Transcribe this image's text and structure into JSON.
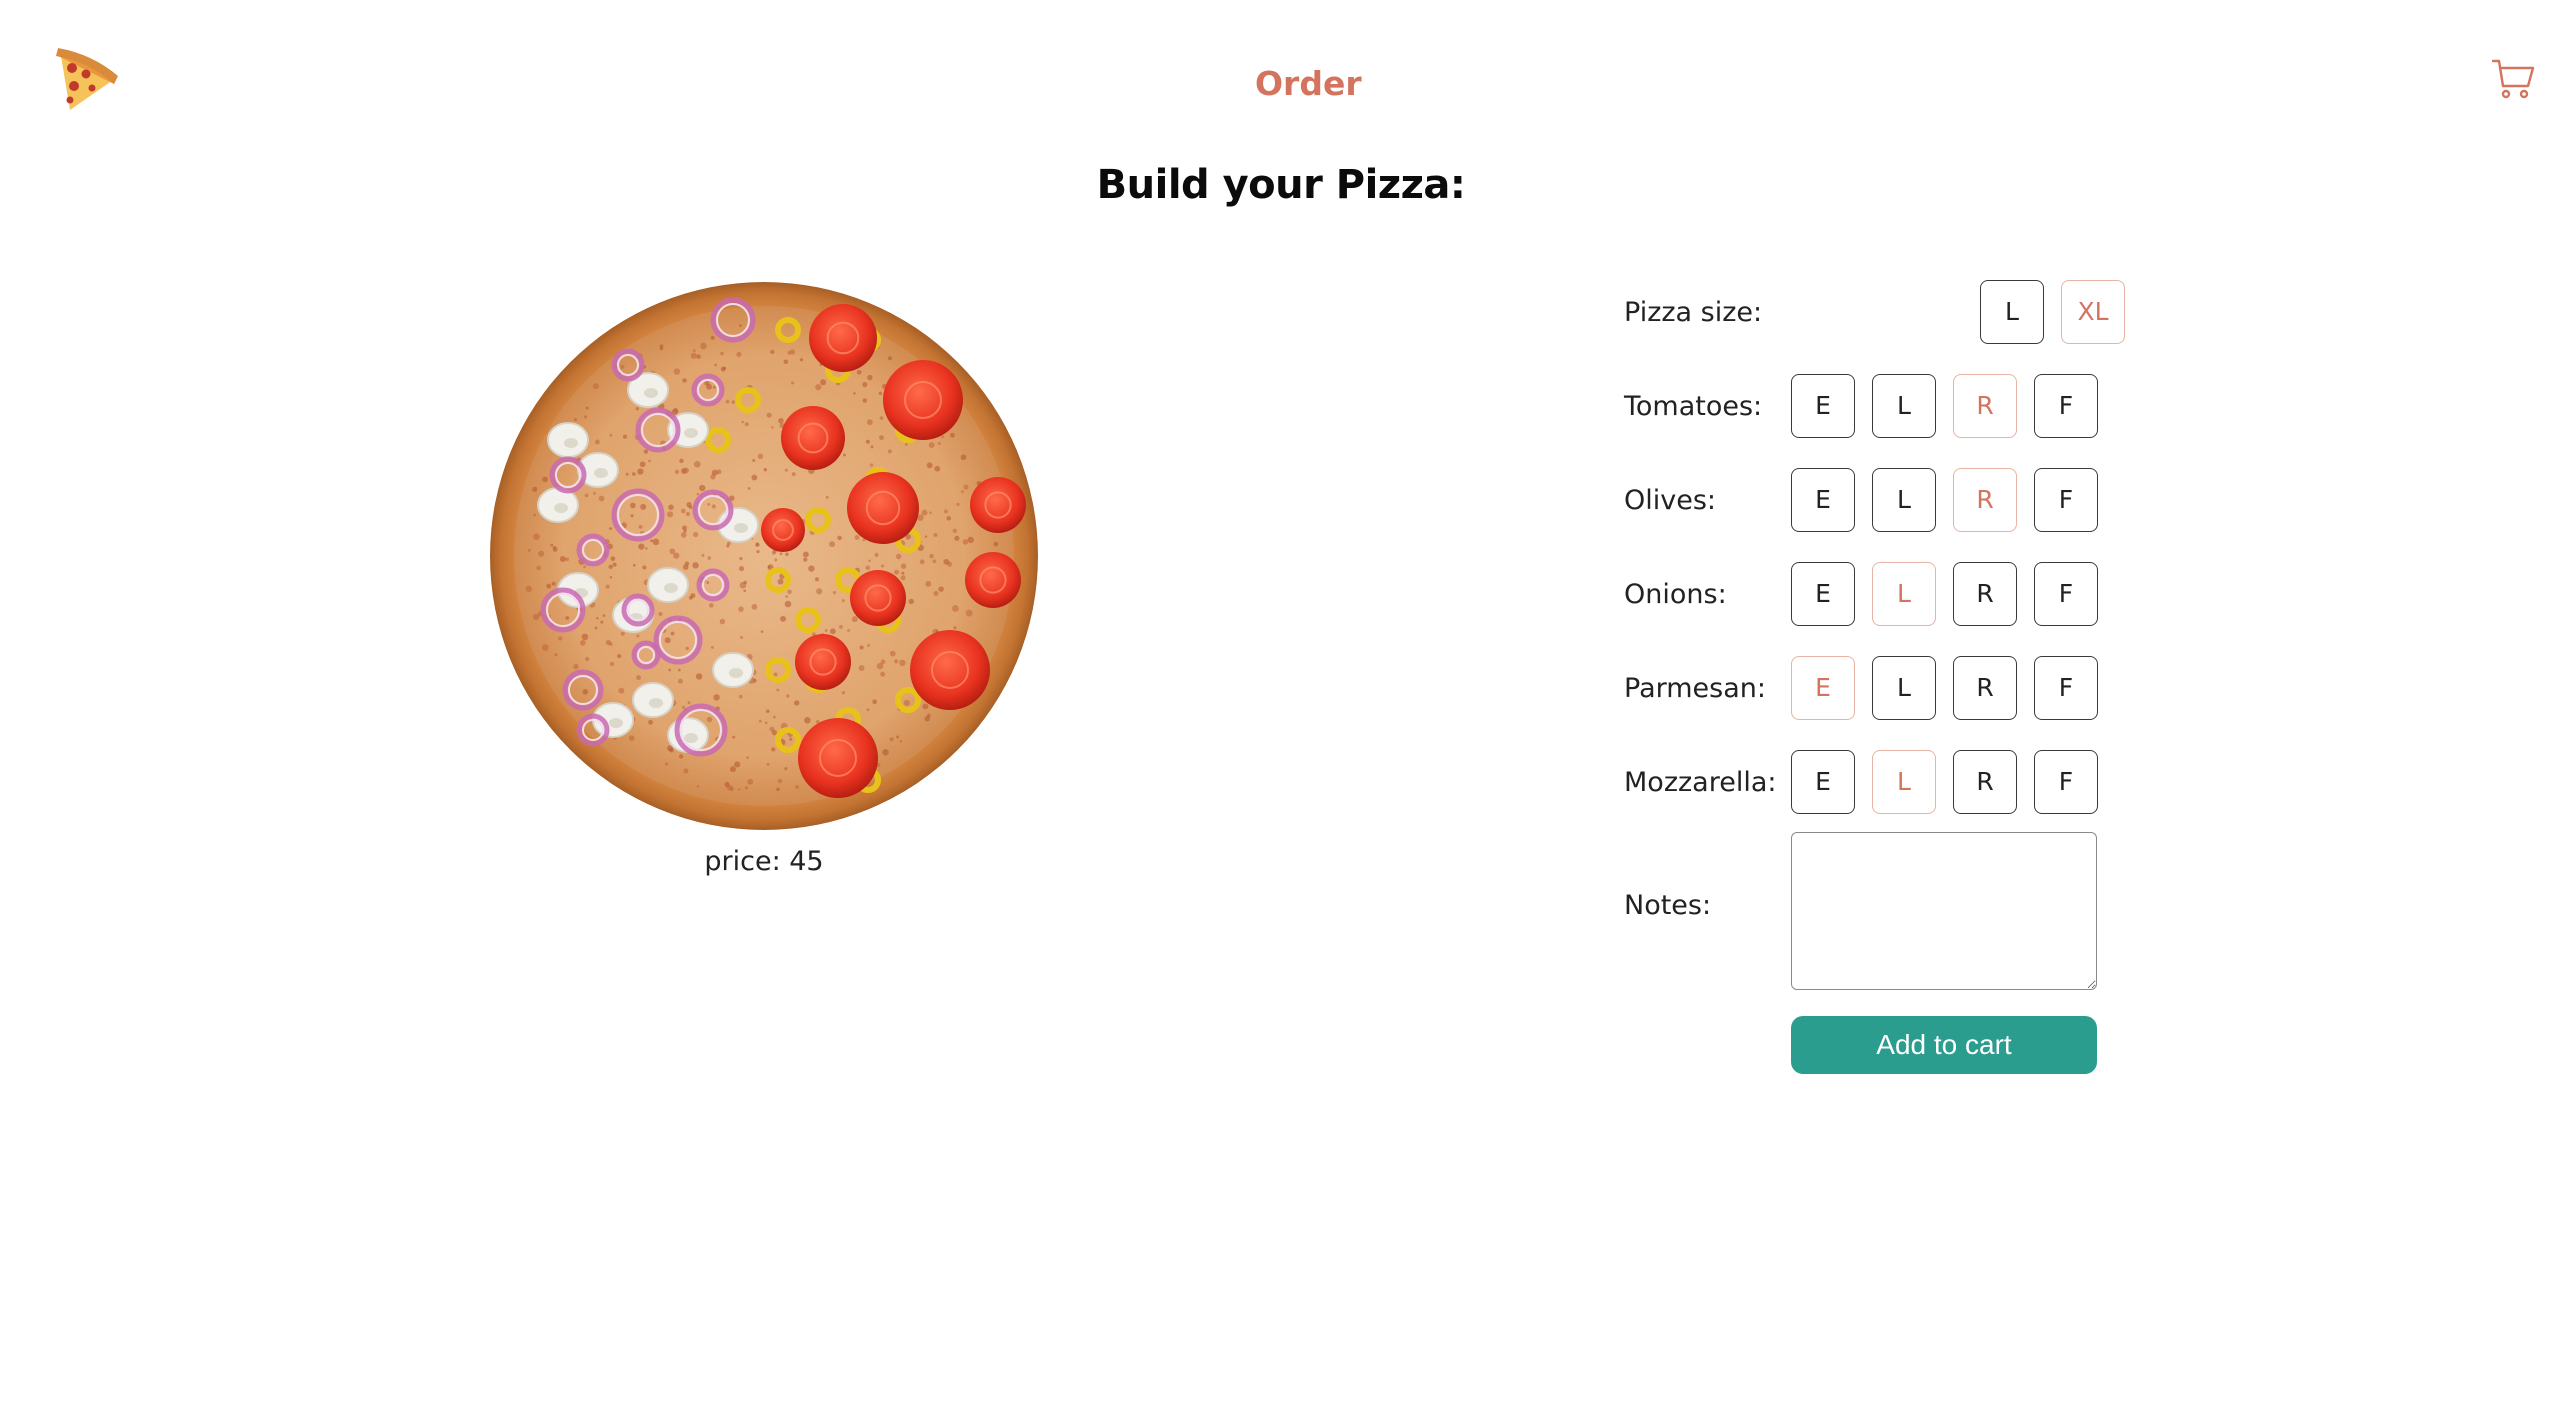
{
  "header": {
    "logo_icon": "pizza-slice-icon",
    "nav_order": "Order",
    "cart_icon": "shopping-cart-icon"
  },
  "title": "Build your Pizza:",
  "price": {
    "label": "price: 45"
  },
  "options": {
    "size": {
      "label": "Pizza size:",
      "choices": [
        "L",
        "XL"
      ],
      "selected": "XL"
    },
    "tomatoes": {
      "label": "Tomatoes:",
      "choices": [
        "E",
        "L",
        "R",
        "F"
      ],
      "selected": "R"
    },
    "olives": {
      "label": "Olives:",
      "choices": [
        "E",
        "L",
        "R",
        "F"
      ],
      "selected": "R"
    },
    "onions": {
      "label": "Onions:",
      "choices": [
        "E",
        "L",
        "R",
        "F"
      ],
      "selected": "L"
    },
    "parmesan": {
      "label": "Parmesan:",
      "choices": [
        "E",
        "L",
        "R",
        "F"
      ],
      "selected": "E"
    },
    "mozzarella": {
      "label": "Mozzarella:",
      "choices": [
        "E",
        "L",
        "R",
        "F"
      ],
      "selected": "L"
    }
  },
  "notes": {
    "label": "Notes:",
    "value": ""
  },
  "add_to_cart": "Add to cart",
  "colors": {
    "accent": "#d4735e",
    "button": "#2a9d8f"
  }
}
